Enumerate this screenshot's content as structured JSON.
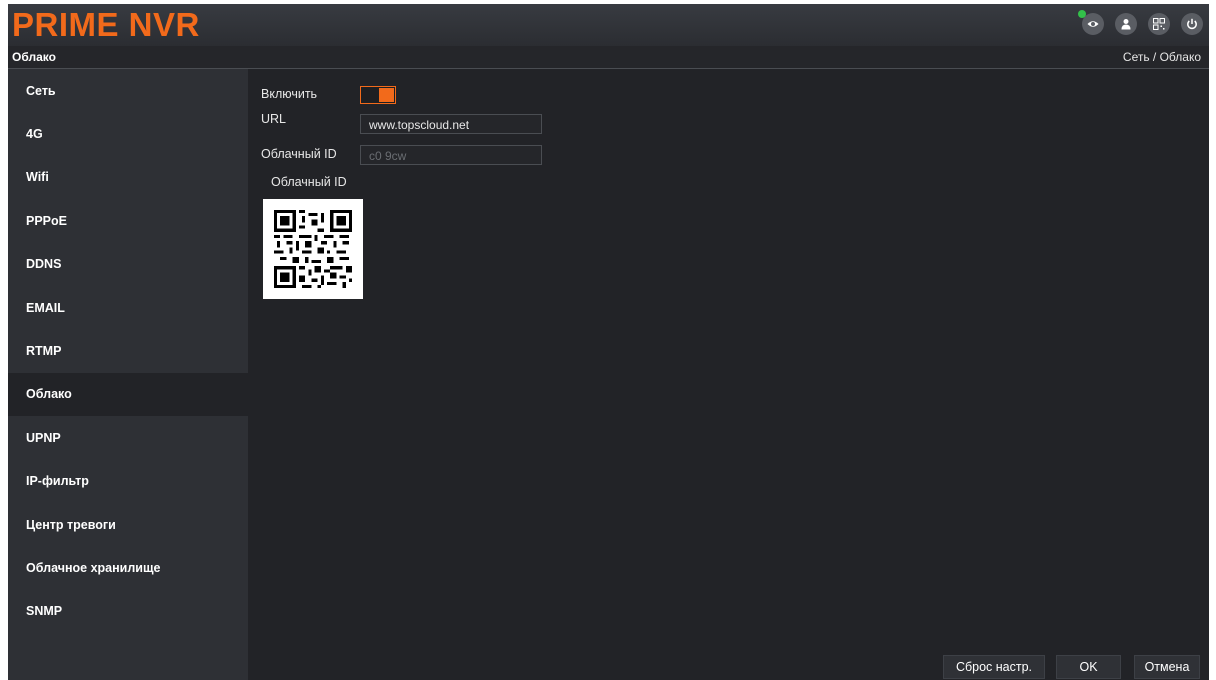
{
  "app": {
    "logo": "PRIME NVR"
  },
  "header_icons": [
    {
      "name": "eye-icon",
      "status": "online",
      "status_color": "#33c14a"
    },
    {
      "name": "user-icon"
    },
    {
      "name": "qr-icon"
    },
    {
      "name": "power-icon"
    }
  ],
  "title": {
    "page": "Облако",
    "breadcrumb": "Сеть  / Облако"
  },
  "sidebar": {
    "items": [
      {
        "label": "Сеть"
      },
      {
        "label": "4G"
      },
      {
        "label": "Wifi"
      },
      {
        "label": "PPPoE"
      },
      {
        "label": "DDNS"
      },
      {
        "label": "EMAIL"
      },
      {
        "label": "RTMP"
      },
      {
        "label": "Облако",
        "active": true
      },
      {
        "label": "UPNP"
      },
      {
        "label": "IP-фильтр"
      },
      {
        "label": "Центр тревоги"
      },
      {
        "label": "Облачное хранилище"
      },
      {
        "label": "SNMP"
      }
    ]
  },
  "form": {
    "enable_label": "Включить",
    "enable_value": "on",
    "url_label": "URL",
    "url_value": "www.topscloud.net",
    "cloud_id_label": "Облачный ID",
    "cloud_id_value": "c0   9cw",
    "qr_label": "Облачный ID"
  },
  "buttons": {
    "reset": "Сброс настр.",
    "ok": "OK",
    "cancel": "Отмена"
  },
  "colors": {
    "accent": "#f26a1b",
    "background": "#222327",
    "sidebar": "#2e3035"
  }
}
